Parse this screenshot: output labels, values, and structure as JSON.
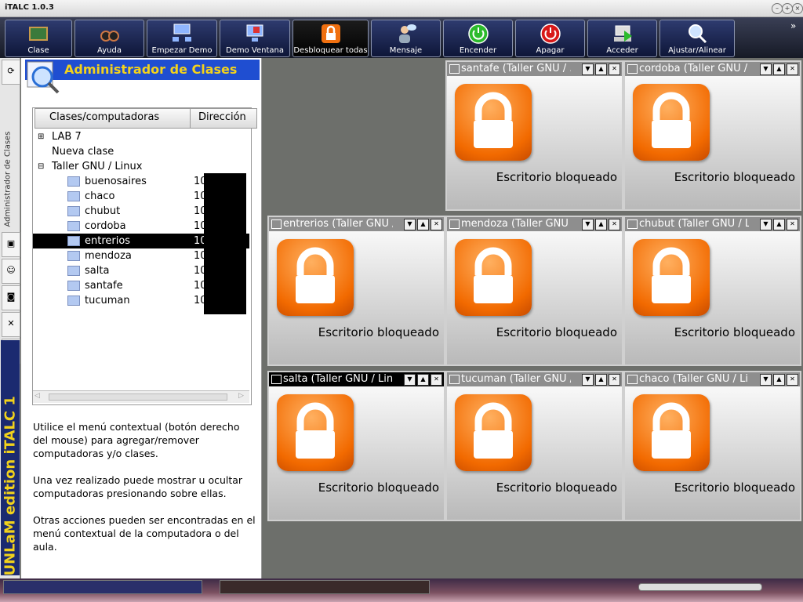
{
  "window": {
    "title": "iTALC 1.0.3"
  },
  "toolbar": {
    "items": [
      {
        "label": "Clase",
        "icon": "chalkboard-icon"
      },
      {
        "label": "Ayuda",
        "icon": "binoculars-icon"
      },
      {
        "label": "Empezar Demo",
        "icon": "demo-icon"
      },
      {
        "label": "Demo Ventana",
        "icon": "window-demo-icon"
      },
      {
        "label": "Desbloquear todas",
        "icon": "unlock-icon"
      },
      {
        "label": "Mensaje",
        "icon": "message-icon"
      },
      {
        "label": "Encender",
        "icon": "power-on-icon"
      },
      {
        "label": "Apagar",
        "icon": "power-off-icon"
      },
      {
        "label": "Acceder",
        "icon": "login-icon"
      },
      {
        "label": "Ajustar/Alinear",
        "icon": "magnifier-icon"
      }
    ],
    "more": "»"
  },
  "sidebar": {
    "title": "Administrador de Clases",
    "vertical_label": "Administrador de Clases",
    "brand": "UNLaM edition iTALC 1"
  },
  "tree": {
    "headers": [
      "Clases/computadoras",
      "Dirección"
    ],
    "groups": [
      "LAB 7",
      "Nueva clase",
      "Taller GNU / Linux"
    ],
    "computers": [
      {
        "name": "buenosaires",
        "ip": "10"
      },
      {
        "name": "chaco",
        "ip": "10"
      },
      {
        "name": "chubut",
        "ip": "10"
      },
      {
        "name": "cordoba",
        "ip": "10"
      },
      {
        "name": "entrerios",
        "ip": "10"
      },
      {
        "name": "mendoza",
        "ip": "10"
      },
      {
        "name": "salta",
        "ip": "10"
      },
      {
        "name": "santafe",
        "ip": "10"
      },
      {
        "name": "tucuman",
        "ip": "10"
      }
    ],
    "selected": "entrerios"
  },
  "help": {
    "p1": "Utilice el menú contextual (botón derecho del mouse) para agregar/remover computadoras y/o clases.",
    "p2": "Una vez realizado puede mostrar u ocultar computadoras  presionando sobre ellas.",
    "p3": "Otras acciones pueden ser encontradas en el menú contextual de la computadora o del aula."
  },
  "screens": [
    {
      "title": "santafe  (Taller GNU / ...",
      "status": "Escritorio bloqueado"
    },
    {
      "title": "cordoba (Taller GNU / ...",
      "status": "Escritorio bloqueado"
    },
    {
      "title": "entrerios (Taller GNU /...",
      "status": "Escritorio bloqueado"
    },
    {
      "title": "mendoza (Taller GNU ...",
      "status": "Escritorio bloqueado"
    },
    {
      "title": "chubut (Taller GNU / L...",
      "status": "Escritorio bloqueado"
    },
    {
      "title": "salta (Taller GNU / Lin...",
      "status": "Escritorio bloqueado"
    },
    {
      "title": "tucuman (Taller GNU /...",
      "status": "Escritorio bloqueado"
    },
    {
      "title": "chaco (Taller GNU / Li...",
      "status": "Escritorio bloqueado"
    }
  ],
  "colors": {
    "accent": "#1f4ed1",
    "brand_text": "#f3d21b",
    "lock": "#f26a00"
  }
}
